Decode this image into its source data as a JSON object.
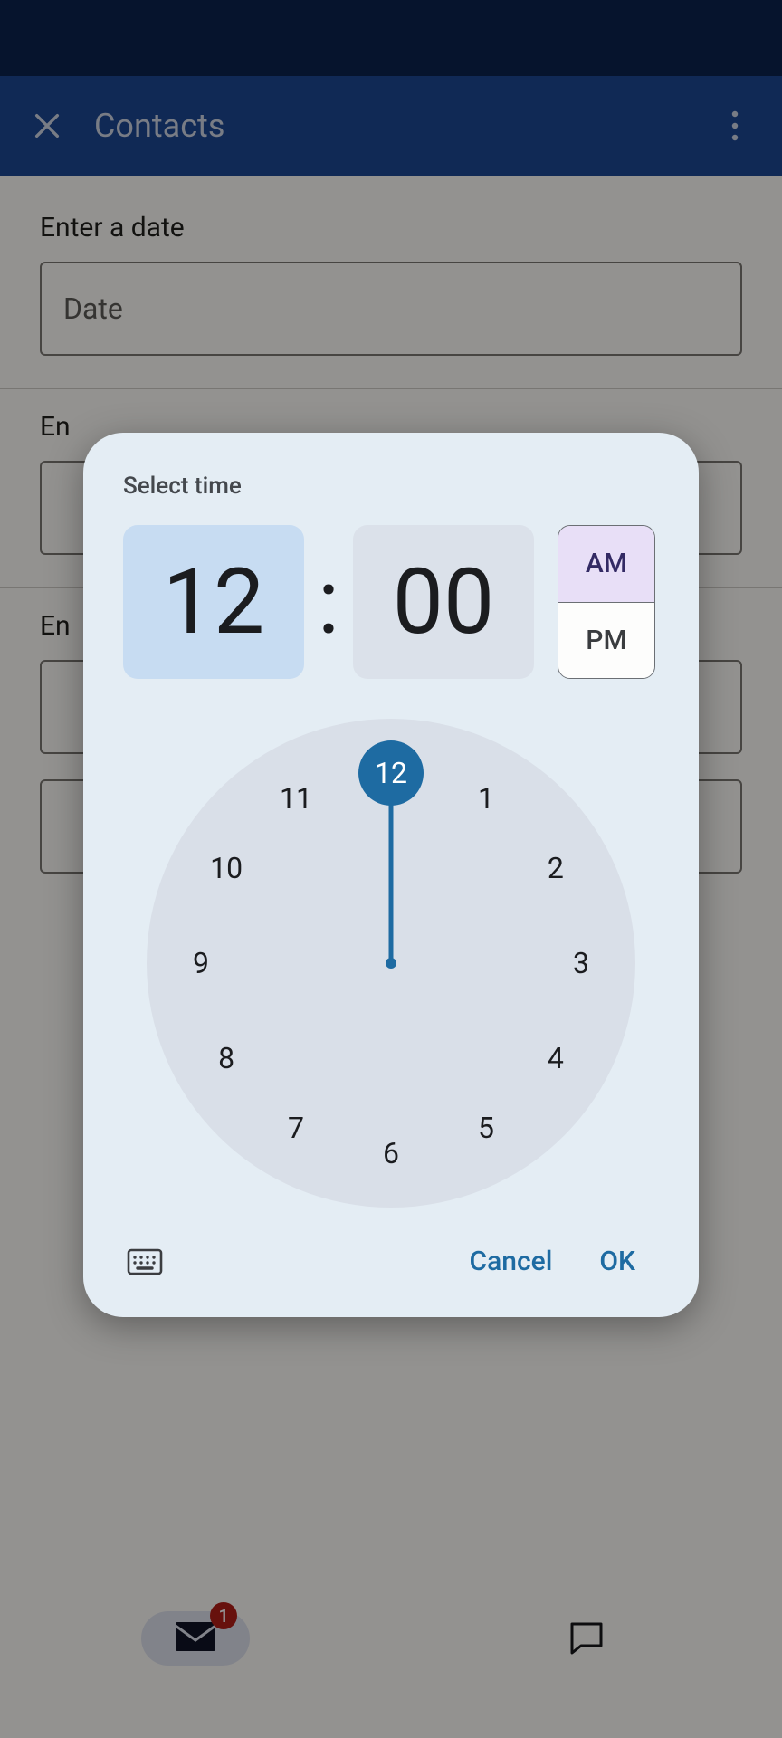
{
  "appbar": {
    "title": "Contacts"
  },
  "form": {
    "date_label": "Enter a date",
    "date_placeholder": "Date",
    "label2_prefix": "En",
    "label3_prefix": "En"
  },
  "bottomnav": {
    "mail_badge": "1"
  },
  "dialog": {
    "title": "Select time",
    "hour": "12",
    "minute": "00",
    "am": "AM",
    "pm": "PM",
    "selected_period": "AM",
    "clock_numbers": [
      "12",
      "1",
      "2",
      "3",
      "4",
      "5",
      "6",
      "7",
      "8",
      "9",
      "10",
      "11"
    ],
    "selected_hour": "12",
    "cancel": "Cancel",
    "ok": "OK"
  }
}
